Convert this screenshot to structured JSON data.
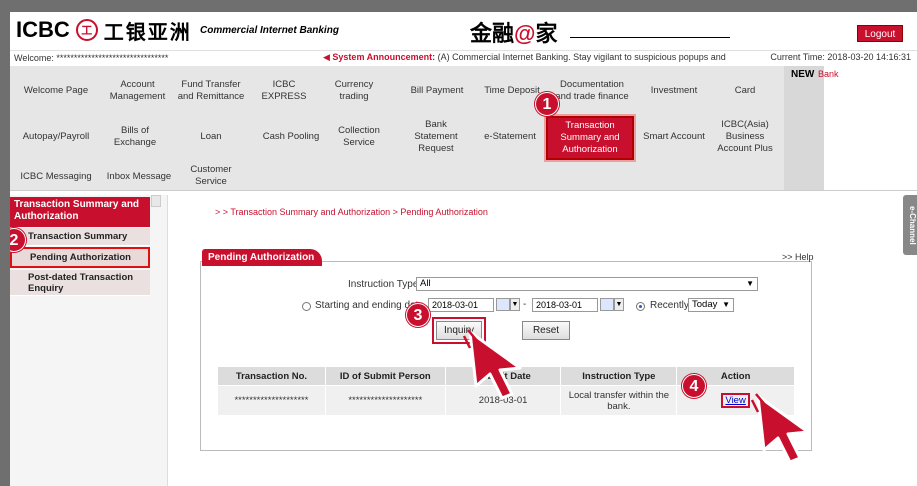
{
  "header": {
    "logo_text": "ICBC",
    "logo_seal": "工",
    "logo_cn": "工银亚洲",
    "tagline": "Commercial Internet Banking",
    "brand_pre": "金融",
    "brand_at": "@",
    "brand_post": "家",
    "logout_label": "Logout"
  },
  "status": {
    "welcome": "Welcome: ********************************",
    "announcement_label": "System Announcement:",
    "announcement_text": "(A) Commercial Internet Banking.    Stay vigilant to suspicious popups and",
    "time": "Current Time: 2018-03-20 14:16:31",
    "new_label": "NEW",
    "bank_label": "Bank"
  },
  "menu": {
    "row1": [
      "Welcome Page",
      "Account Management",
      "Fund Transfer and Remittance",
      "ICBC EXPRESS",
      "Currency trading",
      "Bill Payment",
      "Time Deposit",
      "Documentation and trade finance",
      "Investment",
      "Card"
    ],
    "row2": [
      "Autopay/Payroll",
      "Bills of Exchange",
      "Loan",
      "Cash Pooling",
      "Collection Service",
      "Bank Statement Request",
      "e-Statement",
      "Transaction Summary and Authorization",
      "Smart Account",
      "ICBC(Asia) Business Account Plus"
    ],
    "row3": [
      "ICBC Messaging",
      "Inbox Message",
      "Customer Service"
    ]
  },
  "sidebar": {
    "title": "Transaction Summary and Authorization",
    "items": [
      "Transaction Summary",
      "Pending Authorization",
      "Post-dated Transaction Enquiry"
    ]
  },
  "content": {
    "breadcrumb": "> > Transaction Summary and Authorization > Pending Authorization",
    "echannel": "e-Channel",
    "panel_title": "Pending Authorization",
    "help": ">> Help",
    "instruction_type_label": "Instruction Type:",
    "instruction_type_value": "All",
    "date_range_label": "Starting and ending date",
    "start_date": "2018-03-01",
    "end_date": "2018-03-01",
    "recently_label": "Recently",
    "recently_value": "Today",
    "inquiry_button": "Inquiry",
    "reset_button": "Reset"
  },
  "table": {
    "headers": [
      "Transaction No.",
      "ID of Submit Person",
      "Submit Date",
      "Instruction Type",
      "Action"
    ],
    "rows": [
      {
        "txn": "********************",
        "submitter": "********************",
        "date": "2018-03-01",
        "type": "Local transfer within the bank.",
        "action": "View"
      }
    ]
  },
  "badges": [
    "1",
    "2",
    "3",
    "4"
  ],
  "colors": {
    "accent": "#c8102e",
    "link": "#0000cc"
  }
}
